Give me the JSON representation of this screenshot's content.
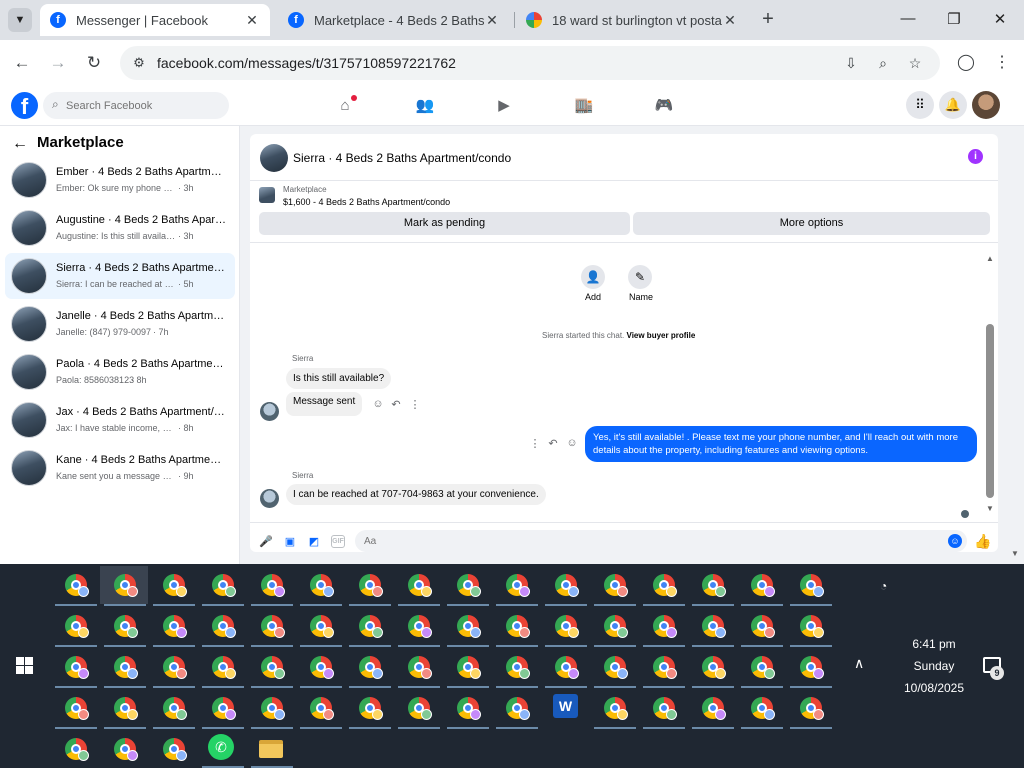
{
  "browser": {
    "tabs": [
      {
        "title": "Messenger | Facebook",
        "favicon": "facebook-icon"
      },
      {
        "title": "Marketplace - 4 Beds 2 Baths Ap",
        "favicon": "facebook-icon"
      },
      {
        "title": "18 ward st burlington vt postal c",
        "favicon": "google-icon"
      }
    ],
    "url": "facebook.com/messages/t/31757108597221762"
  },
  "fb_header": {
    "search_placeholder": "Search Facebook"
  },
  "sidebar": {
    "title": "Marketplace",
    "conversations": [
      {
        "name": "Ember · 4 Beds 2 Baths Apartment...",
        "preview": "Ember: Ok sure my phone number is ...",
        "time": "· 3h"
      },
      {
        "name": "Augustine · 4 Beds 2 Baths Apart...",
        "preview": "Augustine: Is this still available? (302) ...",
        "time": "· 3h"
      },
      {
        "name": "Sierra · 4 Beds 2 Baths Apartment/...",
        "preview": "Sierra: I can be reached at 707-704-98...",
        "time": "· 5h"
      },
      {
        "name": "Janelle · 4 Beds 2 Baths Apartment...",
        "preview": "Janelle: (847) 979-0097",
        "time": "· 7h"
      },
      {
        "name": "Paola · 4 Beds 2 Baths Apartment/...",
        "preview": "Paola: 8586038123",
        "time": "· 8h"
      },
      {
        "name": "Jax · 4 Beds 2 Baths Apartment/co...",
        "preview": "Jax: I have stable income, strong refer...",
        "time": "· 8h"
      },
      {
        "name": "Kane · 4 Beds 2 Baths Apartment/...",
        "preview": "Kane sent you a message about your l...",
        "time": "· 9h"
      }
    ]
  },
  "chat": {
    "title": "Sierra · 4 Beds 2 Baths Apartment/condo",
    "marketplace_label": "Marketplace",
    "listing": "$1,600 - 4 Beds 2 Baths Apartment/condo",
    "mark_pending": "Mark as pending",
    "more_options": "More options",
    "add_label": "Add",
    "name_label": "Name",
    "system_text": "Sierra started this chat.",
    "system_link": "View buyer profile",
    "sender": "Sierra",
    "msg1": "Is this still available?",
    "msg2": "Message sent",
    "msg_out": "Yes, it's still available! . Please text me your phone number, and I'll reach out with more details about the property, including features and viewing options.",
    "msg3": "I can be reached at 707-704-9863 at your convenience.",
    "composer_placeholder": "Aa",
    "gif_label": "GIF"
  },
  "taskbar": {
    "time": "6:41 pm",
    "day": "Sunday",
    "date": "10/08/2025",
    "notifications": "9",
    "word_label": "W"
  },
  "colors": {
    "facebook_blue": "#0866ff",
    "outgoing_bubble": "#0a66ff",
    "active_conversation": "#ebf5ff",
    "taskbar": "#1f2732"
  }
}
